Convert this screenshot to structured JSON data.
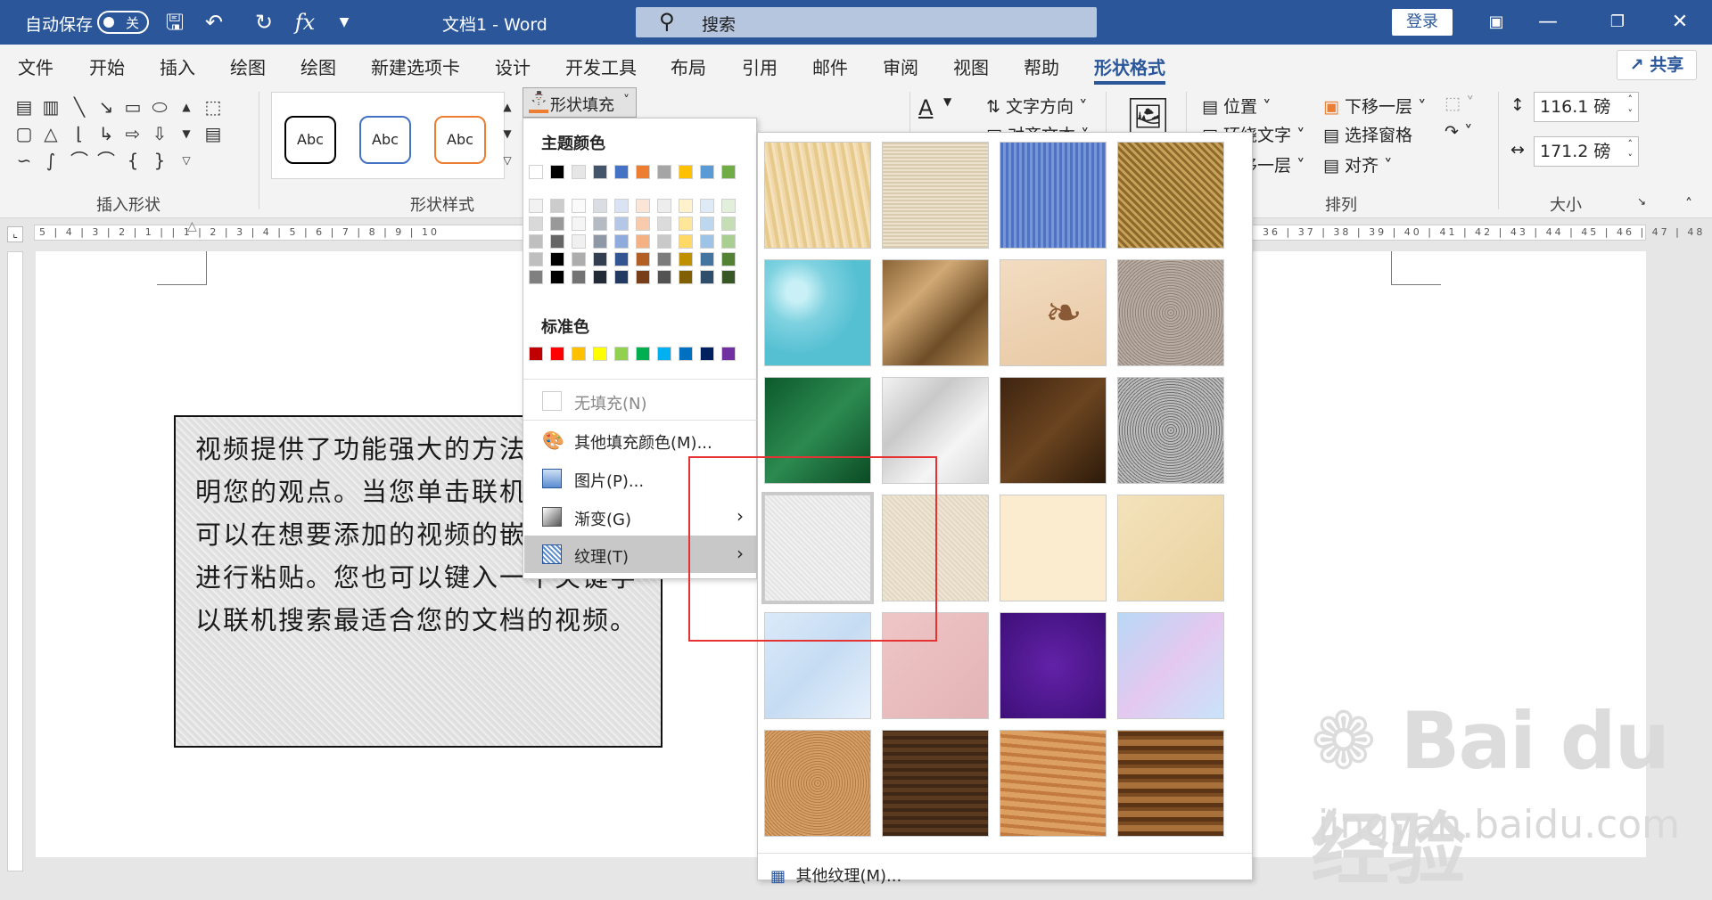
{
  "titlebar": {
    "autosave_label": "自动保存",
    "autosave_state": "关",
    "doc_title": "文档1  -  Word",
    "search_placeholder": "搜索",
    "login_label": "登录"
  },
  "tabs": [
    "文件",
    "开始",
    "插入",
    "绘图",
    "绘图",
    "新建选项卡",
    "设计",
    "开发工具",
    "布局",
    "引用",
    "邮件",
    "审阅",
    "视图",
    "帮助",
    "形状格式"
  ],
  "share_label": "共享",
  "ribbon": {
    "insert_shapes_label": "插入形状",
    "shape_styles_label": "形状样式",
    "style_samples": [
      "Abc",
      "Abc",
      "Abc"
    ],
    "shape_fill_label": "形状填充",
    "text_direction_label": "文字方向",
    "align_text_label": "对齐文本",
    "position_label": "位置",
    "wrap_text_label": "环绕文字",
    "bring_forward_label": "上移一层",
    "send_backward_label": "下移一层",
    "selection_pane_label": "选择窗格",
    "align_label": "对齐",
    "arrange_label": "排列",
    "size_label": "大小",
    "height_value": "116.1 磅",
    "width_value": "171.2 磅"
  },
  "ruler_numbers": "5 | 4 | 3 | 2 | 1 |   | 1 | 2 | 3 | 4 | 5 | 6 | 7 | 8 | 9 | 10",
  "ruler_numbers_right": "36 | 37 | 38 | 39 | 40 | 41 | 42 | 43 | 44 | 45 | 46 | 47 | 48",
  "document": {
    "textbox_text": "视频提供了功能强大的方法帮助您证明您的观点。当您单击联机视频时，可以在想要添加的视频的嵌入代码中进行粘贴。您也可以键入一个关键字以联机搜索最适合您的文档的视频。"
  },
  "fill_menu": {
    "theme_colors_label": "主题颜色",
    "standard_colors_label": "标准色",
    "no_fill": "无填充(N)",
    "more_fill_colors": "其他填充颜色(M)...",
    "picture": "图片(P)...",
    "gradient": "渐变(G)",
    "texture": "纹理(T)",
    "theme_colors": [
      "#ffffff",
      "#000000",
      "#e7e6e6",
      "#44546a",
      "#4472c4",
      "#ed7d31",
      "#a5a5a5",
      "#ffc000",
      "#5b9bd5",
      "#70ad47"
    ],
    "standard_colors": [
      "#c00000",
      "#ff0000",
      "#ffc000",
      "#ffff00",
      "#92d050",
      "#00b050",
      "#00b0f0",
      "#0070c0",
      "#002060",
      "#7030a0"
    ]
  },
  "texture_panel": {
    "more_textures": "其他纹理(M)..."
  },
  "watermark": {
    "logo": "Bai du 经验",
    "url": "jingyan.baidu.com"
  }
}
